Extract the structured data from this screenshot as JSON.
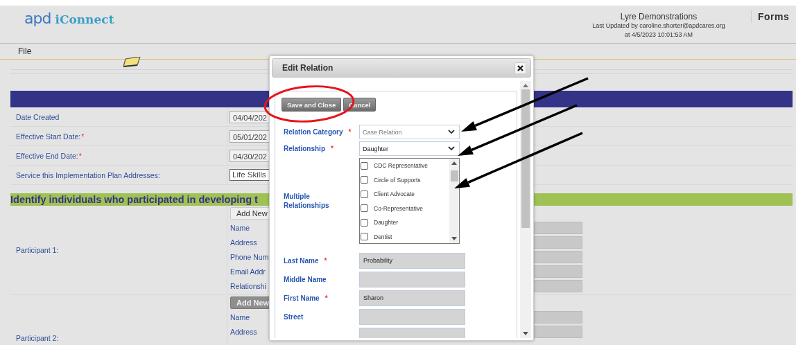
{
  "header": {
    "logo_mark": "apd",
    "logo_text": "iConnect",
    "organization": "Lyre Demonstrations",
    "last_updated": "Last Updated by caroline.shorter@apdcares.org",
    "updated_at": "at 4/5/2023 10:01:53 AM",
    "section": "Forms"
  },
  "menu": [
    "File"
  ],
  "plan_fields": [
    {
      "label": "Date Created",
      "value": "04/04/202",
      "kind": "input"
    },
    {
      "label": "Effective Start Date:",
      "required_mark": "*",
      "value": "05/01/202",
      "kind": "input"
    },
    {
      "label": "Effective End Date:",
      "required_mark": "*",
      "value": "04/30/202",
      "kind": "input"
    },
    {
      "label": "Service this Implementation Plan Addresses:",
      "value": "Life Skills",
      "kind": "select"
    }
  ],
  "participants_heading": "Identify individuals who participated in developing t",
  "participants": [
    {
      "label": "Participant 1:",
      "button": "Add New",
      "kind": "light",
      "fields": [
        "Name",
        "Address",
        "Phone Num",
        "Email Addr",
        "Relationshi"
      ]
    },
    {
      "label": "Participant 2:",
      "button": "Add New",
      "kind": "dark",
      "fields": [
        "Name",
        "Address"
      ]
    }
  ],
  "dialog": {
    "title": "Edit Relation",
    "buttons": [
      "Save and Close",
      "Cancel"
    ],
    "fields": [
      {
        "kind": "select",
        "label": "Relation Category",
        "required_mark": "*",
        "value": "Case Relation",
        "disabled": true
      },
      {
        "kind": "select",
        "label": "Relationship",
        "required_mark": "*",
        "value": "Daughter",
        "disabled": false
      },
      {
        "kind": "checklist",
        "label": "Multiple Relationships",
        "options": [
          {
            "label": "CDC Representative",
            "checked": false
          },
          {
            "label": "Circle of Supports",
            "checked": false
          },
          {
            "label": "Client Advocate",
            "checked": false
          },
          {
            "label": "Co-Representative",
            "checked": false
          },
          {
            "label": "Daughter",
            "checked": false
          },
          {
            "label": "Dentist",
            "checked": false
          }
        ]
      },
      {
        "kind": "text",
        "label": "Last Name",
        "required_mark": "*",
        "value": "Probability"
      },
      {
        "kind": "text",
        "label": "Middle Name"
      },
      {
        "kind": "text",
        "label": "First Name",
        "required_mark": "*",
        "value": "Sharon"
      },
      {
        "kind": "text",
        "label": "Street"
      },
      {
        "kind": "text"
      }
    ]
  }
}
